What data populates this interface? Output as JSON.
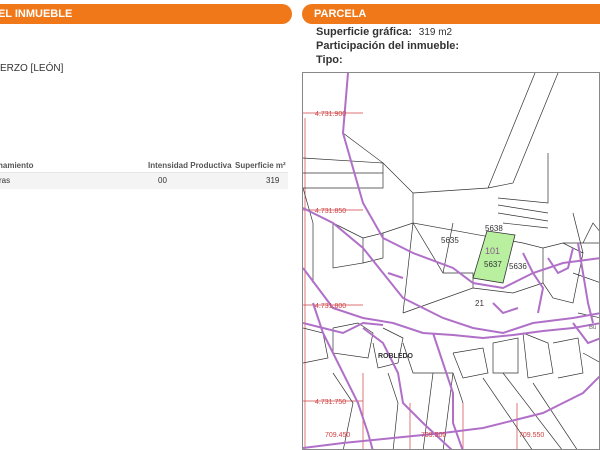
{
  "left_panel": {
    "header": "DEL INMUEBLE",
    "location": "ERZO [LEÓN]",
    "table": {
      "headers": [
        "hamiento",
        "Intensidad Productiva",
        "Superficie m²"
      ],
      "rows": [
        {
          "use": "ras",
          "intensity": "00",
          "surface": "319"
        }
      ]
    }
  },
  "right_panel": {
    "header": "PARCELA",
    "surface_label": "Superficie gráfica:",
    "surface_value": "319 m2",
    "participation_label": "Participación del inmueble:",
    "type_label": "Tipo:"
  },
  "map": {
    "y_labels": [
      "4.731.900",
      "4.731.850",
      "4.731.800",
      "4.731.750"
    ],
    "x_labels": [
      "709.450",
      "709.500",
      "709.550"
    ],
    "parcels": [
      "5638",
      "5635",
      "101",
      "5637",
      "5636",
      "21"
    ],
    "place_name": "ROBLEDO",
    "edge_label": "Bu",
    "colors": {
      "highlight": "#b8f0a0",
      "roads": "#b070c8",
      "grid": "#d04040",
      "lines": "#333333"
    }
  }
}
